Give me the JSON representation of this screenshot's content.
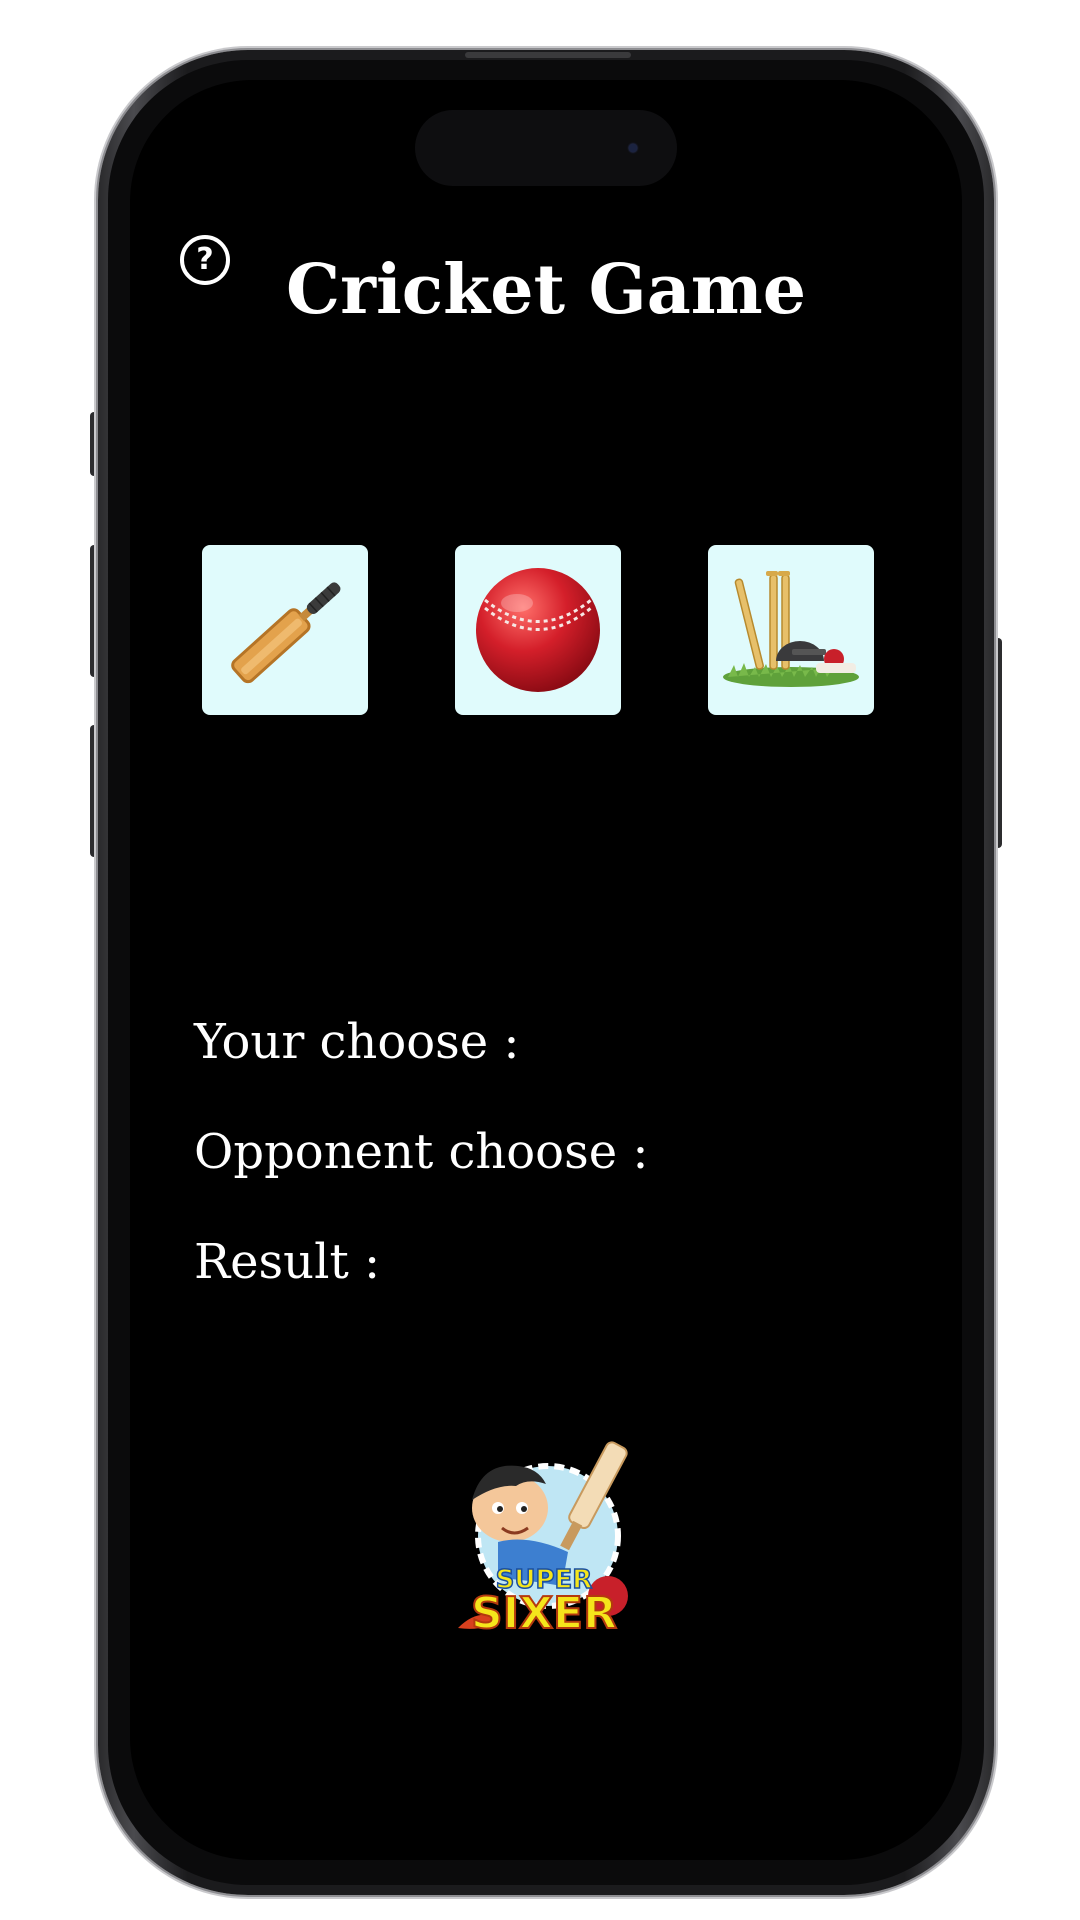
{
  "app": {
    "title": "Cricket Game"
  },
  "header": {
    "help_icon": "question-circle-icon",
    "help_glyph": "?"
  },
  "choices": [
    {
      "name": "bat",
      "icon": "cricket-bat-icon"
    },
    {
      "name": "ball",
      "icon": "cricket-ball-icon"
    },
    {
      "name": "stumps",
      "icon": "cricket-stumps-icon"
    }
  ],
  "results": {
    "your_choice_label": "Your choose :",
    "opponent_choice_label": "Opponent choose :",
    "result_label": "Result :"
  },
  "logo": {
    "line1": "SUPER",
    "line2": "SIXER"
  },
  "colors": {
    "background": "#000000",
    "text": "#ffffff",
    "choice_tile": "#e0fbfc",
    "ball_red": "#d41f2a",
    "logo_yellow": "#f5e51b"
  }
}
